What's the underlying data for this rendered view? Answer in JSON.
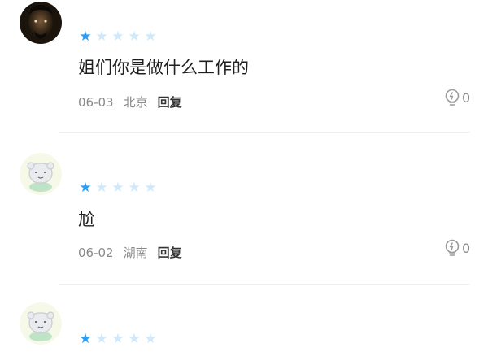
{
  "colors": {
    "star_filled": "#2a9df4",
    "star_empty": "#cfe9fb",
    "meta_text": "#8a8a8a",
    "reply_text": "#333333"
  },
  "comments": [
    {
      "avatar": "photo-avatar",
      "rating": 1,
      "max_rating": 5,
      "text": "姐们你是做什么工作的",
      "date": "06-03",
      "location": "北京",
      "reply_label": "回复",
      "like_icon": "lightbulb-icon",
      "like_count": "0"
    },
    {
      "avatar": "default-cartoon-avatar",
      "rating": 1,
      "max_rating": 5,
      "text": "尬",
      "date": "06-02",
      "location": "湖南",
      "reply_label": "回复",
      "like_icon": "lightbulb-icon",
      "like_count": "0"
    },
    {
      "avatar": "default-cartoon-avatar",
      "rating": 1,
      "max_rating": 5
    }
  ]
}
